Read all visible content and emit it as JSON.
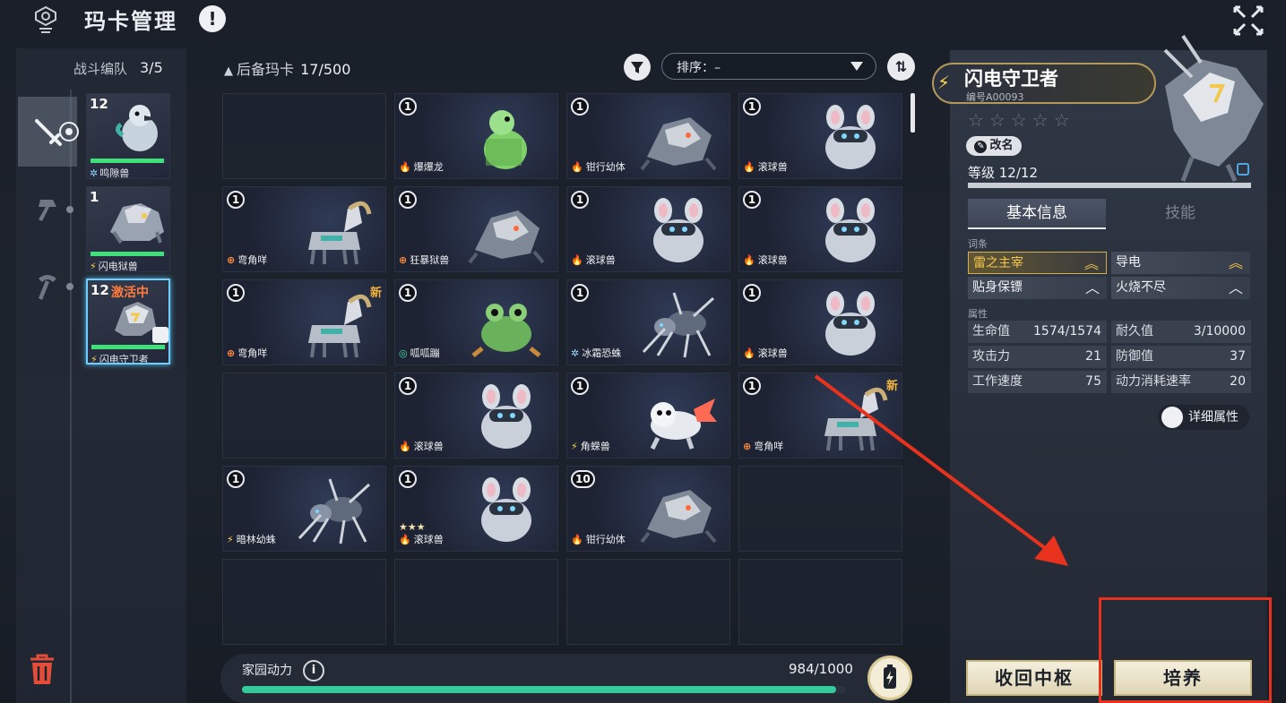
{
  "header": {
    "title": "玛卡管理",
    "info": "!"
  },
  "team": {
    "label": "战斗编队",
    "count": "3/5",
    "cards": [
      {
        "level": "12",
        "name": "鸣隙兽",
        "element": "ice",
        "hp": 0.95,
        "active": ""
      },
      {
        "level": "1",
        "name": "闪电狱兽",
        "element": "bolt",
        "hp": 0.95,
        "active": ""
      },
      {
        "level": "12",
        "name": "闪电守卫者",
        "element": "bolt",
        "hp": 0.95,
        "active": "激活中"
      }
    ]
  },
  "reserve": {
    "label": "后备玛卡",
    "count": "17/500"
  },
  "sort": {
    "label": "排序：–"
  },
  "grid": [
    {
      "empty": true
    },
    {
      "level": "1",
      "name": "爆爆龙",
      "element": "fire",
      "pet": "dino"
    },
    {
      "level": "1",
      "name": "钳行幼体",
      "element": "fire",
      "pet": "mech"
    },
    {
      "level": "1",
      "name": "滚球兽",
      "element": "fire",
      "pet": "mouse"
    },
    {
      "level": "1",
      "name": "弯角咩",
      "element": "plus",
      "pet": "goat"
    },
    {
      "level": "1",
      "name": "狂暴狱兽",
      "element": "plus",
      "pet": "mech"
    },
    {
      "level": "1",
      "name": "滚球兽",
      "element": "fire",
      "pet": "mouse"
    },
    {
      "level": "1",
      "name": "滚球兽",
      "element": "fire",
      "pet": "mouse"
    },
    {
      "level": "1",
      "name": "弯角咩",
      "element": "plus",
      "pet": "goat",
      "new": "新"
    },
    {
      "level": "1",
      "name": "呱呱蹦",
      "element": "wind",
      "pet": "frog"
    },
    {
      "level": "1",
      "name": "冰霜恐蛛",
      "element": "ice",
      "pet": "spider"
    },
    {
      "level": "1",
      "name": "滚球兽",
      "element": "fire",
      "pet": "mouse"
    },
    {
      "empty": true
    },
    {
      "level": "1",
      "name": "滚球兽",
      "element": "fire",
      "pet": "mouse"
    },
    {
      "level": "1",
      "name": "角蝾兽",
      "element": "bolt",
      "pet": "axolotl"
    },
    {
      "level": "1",
      "name": "弯角咩",
      "element": "plus",
      "pet": "goat",
      "new": "新"
    },
    {
      "level": "1",
      "name": "暗林幼蛛",
      "element": "bolt",
      "pet": "spider"
    },
    {
      "level": "1",
      "name": "滚球兽",
      "element": "fire",
      "pet": "mouse",
      "stars": "★★★"
    },
    {
      "level": "10",
      "name": "钳行幼体",
      "element": "fire",
      "pet": "mech"
    },
    {
      "empty": true
    },
    {
      "empty": true
    },
    {
      "empty": true
    },
    {
      "empty": true
    },
    {
      "empty": true
    }
  ],
  "power": {
    "label": "家园动力",
    "value": "984/1000",
    "ratio": 0.984
  },
  "detail": {
    "name": "闪电守卫者",
    "id": "编号A00093",
    "stars": "☆☆☆☆☆",
    "rename": "改名",
    "level": "等级 12/12",
    "tabs": [
      "基本信息",
      "技能"
    ],
    "traits_label": "词条",
    "traits": [
      {
        "name": "雷之主宰",
        "gold": true
      },
      {
        "name": "导电",
        "gold": false
      },
      {
        "name": "贴身保镖",
        "gold": false
      },
      {
        "name": "火烧不尽",
        "gold": false
      }
    ],
    "attrs_label": "属性",
    "attrs": [
      {
        "k": "生命值",
        "v": "1574/1574"
      },
      {
        "k": "耐久值",
        "v": "3/10000"
      },
      {
        "k": "攻击力",
        "v": "21"
      },
      {
        "k": "防御值",
        "v": "37"
      },
      {
        "k": "工作速度",
        "v": "75"
      },
      {
        "k": "动力消耗速率",
        "v": "20"
      }
    ],
    "detail_btn": "详细属性",
    "recall_btn": "收回中枢",
    "train_btn": "培养"
  },
  "colors": {
    "bolt": "#ffd84a",
    "fire": "#ff6a3d",
    "ice": "#9fdcff",
    "plus": "#ff8a3d",
    "wind": "#42e0a8",
    "accent": "#35c99a",
    "annotation": "#e8321e"
  }
}
